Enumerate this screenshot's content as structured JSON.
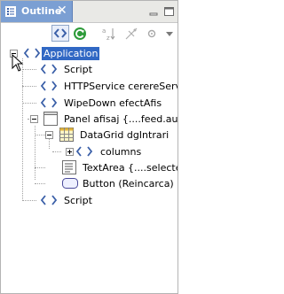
{
  "view": {
    "title": "Outline",
    "close_glyph": "✕"
  },
  "toolbar": {
    "buttons": [
      {
        "name": "sync-selection-button",
        "icon": "angle-brackets-icon"
      },
      {
        "name": "go-button",
        "icon": "green-refresh-icon"
      },
      {
        "name": "sort-button",
        "icon": "sort-az-icon"
      },
      {
        "name": "filter-button",
        "icon": "filter-icon"
      },
      {
        "name": "settings-button",
        "icon": "gear-icon"
      },
      {
        "name": "view-menu-button",
        "icon": "chevron-down-icon"
      }
    ]
  },
  "tree": {
    "nodes": [
      {
        "label": "Application",
        "selected": true
      },
      {
        "label": "Script"
      },
      {
        "label": "HTTPService cerereServic"
      },
      {
        "label": "WipeDown efectAfis"
      },
      {
        "label": "Panel afisaj {....feed.author"
      },
      {
        "label": "DataGrid dgIntrari"
      },
      {
        "label": "columns"
      },
      {
        "label": "TextArea {....selectedI"
      },
      {
        "label": "Button (Reincarca)"
      },
      {
        "label": "Script"
      }
    ]
  },
  "colors": {
    "tab_active": "#7b9fd3",
    "selection": "#3168c4",
    "tag_icon": "#3a5fa8"
  }
}
